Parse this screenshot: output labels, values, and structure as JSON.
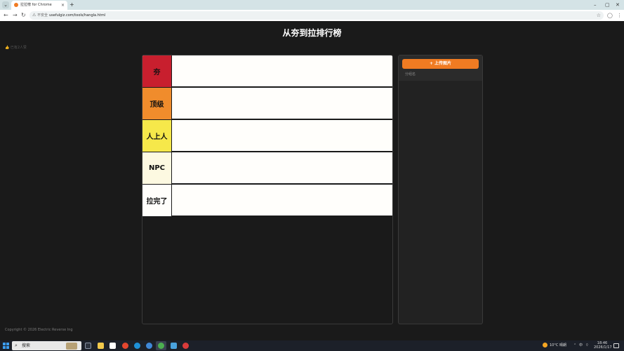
{
  "browser": {
    "tab_title": "拉拉榜 for Chrome",
    "new_tab": "+",
    "tab_close": "×",
    "secure_label": "不安全",
    "url": "usefulgiz.com/tools/hangla.html",
    "window_controls": {
      "minimize": "–",
      "maximize": "▢",
      "close": "✕"
    }
  },
  "page": {
    "title": "从夯到拉排行榜",
    "like_text": "已有2人赞",
    "tiers": [
      {
        "label": "夯",
        "color": "#c81f2e"
      },
      {
        "label": "顶级",
        "color": "#f08c2c"
      },
      {
        "label": "人上人",
        "color": "#f6e84a"
      },
      {
        "label": "NPC",
        "color": "#fdf9e1"
      },
      {
        "label": "拉完了",
        "color": "#fffefb"
      }
    ],
    "upload_label": "+ 上传图片",
    "group_label": "分组名",
    "footer": "Copyright © 2026 Electric Reverse Ing"
  },
  "taskbar": {
    "search_placeholder": "搜索",
    "weather": "10°C 晴朗",
    "ime": "中",
    "time": "18:46",
    "date": "2026/1/17"
  },
  "colors": {
    "accent": "#f07b22",
    "page_background": "#1a1a1a"
  }
}
